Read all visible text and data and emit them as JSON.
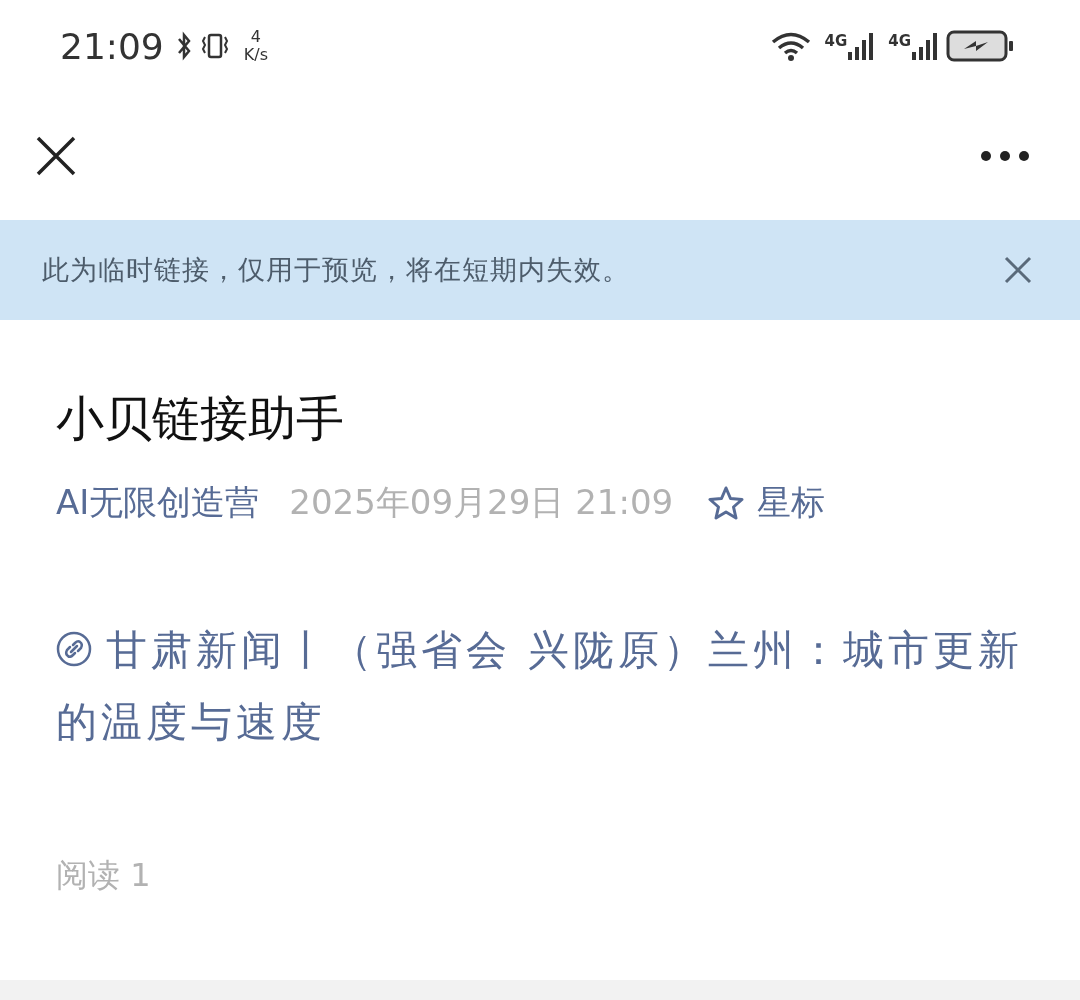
{
  "status_bar": {
    "time": "21:09",
    "net_speed": {
      "value": "4",
      "unit": "K/s"
    },
    "networks": [
      "4G",
      "4G"
    ]
  },
  "notice": {
    "text": "此为临时链接，仅用于预览，将在短期内失效。"
  },
  "article": {
    "title": "小贝链接助手",
    "account": "AI无限创造营",
    "date": "2025年09月29日 21:09",
    "star_label": "星标",
    "link_text": "甘肃新闻丨（强省会 兴陇原）兰州：城市更新的温度与速度",
    "read_count": "阅读 1"
  }
}
